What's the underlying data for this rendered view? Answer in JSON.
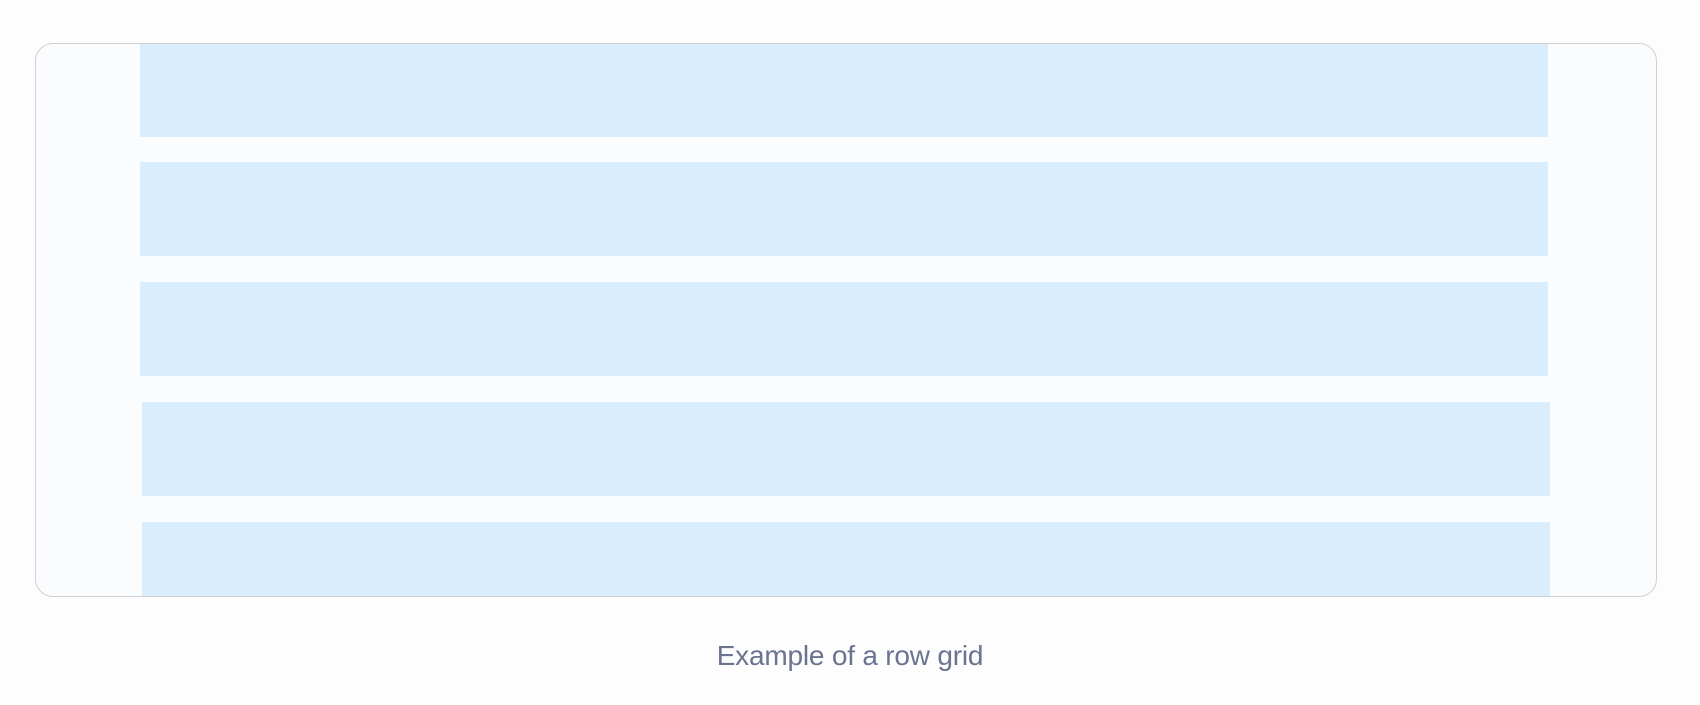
{
  "figure": {
    "caption": "Example of a row grid",
    "colors": {
      "page_background": "#fdfdfe",
      "frame_background": "#fafcfe",
      "frame_border": "#cfd1d6",
      "row_fill": "#d9edfd",
      "caption_text": "#6b7390"
    },
    "row_count": 5
  }
}
